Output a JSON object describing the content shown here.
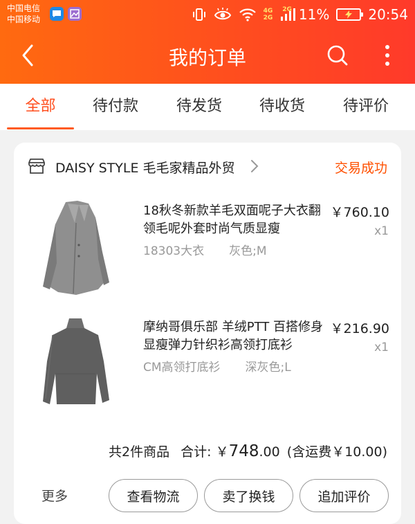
{
  "status_bar": {
    "carrier_1": "中国电信",
    "carrier_2": "中国移动",
    "net_tag_1": "4G",
    "net_tag_2": "2G",
    "net_tag_3": "2G",
    "battery": "11%",
    "time": "20:54",
    "icons": [
      "message-app-icon",
      "gallery-app-icon",
      "vibrate-icon",
      "eye-comfort-icon",
      "wifi-icon",
      "signal-icon",
      "battery-charging-icon"
    ]
  },
  "header": {
    "title": "我的订单",
    "icons": [
      "back-arrow-icon",
      "search-icon",
      "more-vertical-icon"
    ],
    "accent": "#ff4e1e"
  },
  "tabs": [
    {
      "label": "全部",
      "active": true
    },
    {
      "label": "待付款",
      "active": false
    },
    {
      "label": "待发货",
      "active": false
    },
    {
      "label": "待收货",
      "active": false
    },
    {
      "label": "待评价",
      "active": false
    }
  ],
  "order": {
    "shop_name": "DAISY STYLE 毛毛家精品外贸",
    "status": "交易成功",
    "status_color": "#ff5000",
    "items": [
      {
        "title": "18秋冬新款羊毛双面呢子大衣翻领毛呢外套时尚气质显瘦",
        "sku_code": "18303大衣",
        "sku_spec": "灰色;M",
        "price": "￥760.10",
        "qty": "x1",
        "image": "grey-wool-coat"
      },
      {
        "title": "摩纳哥俱乐部 羊绒PTT 百搭修身显瘦弹力针织衫高领打底衫",
        "sku_code": "CM高领打底衫",
        "sku_spec": "深灰色;L",
        "price": "￥216.90",
        "qty": "x1",
        "image": "grey-turtleneck-sweater"
      }
    ],
    "summary": {
      "count_text": "共2件商品",
      "total_label": "合计:",
      "currency": "￥",
      "total_int": "748",
      "total_dec": ".00",
      "shipping": "(含运费￥10.00)"
    },
    "actions": {
      "more": "更多",
      "buttons": [
        "查看物流",
        "卖了换钱",
        "追加评价"
      ]
    }
  }
}
